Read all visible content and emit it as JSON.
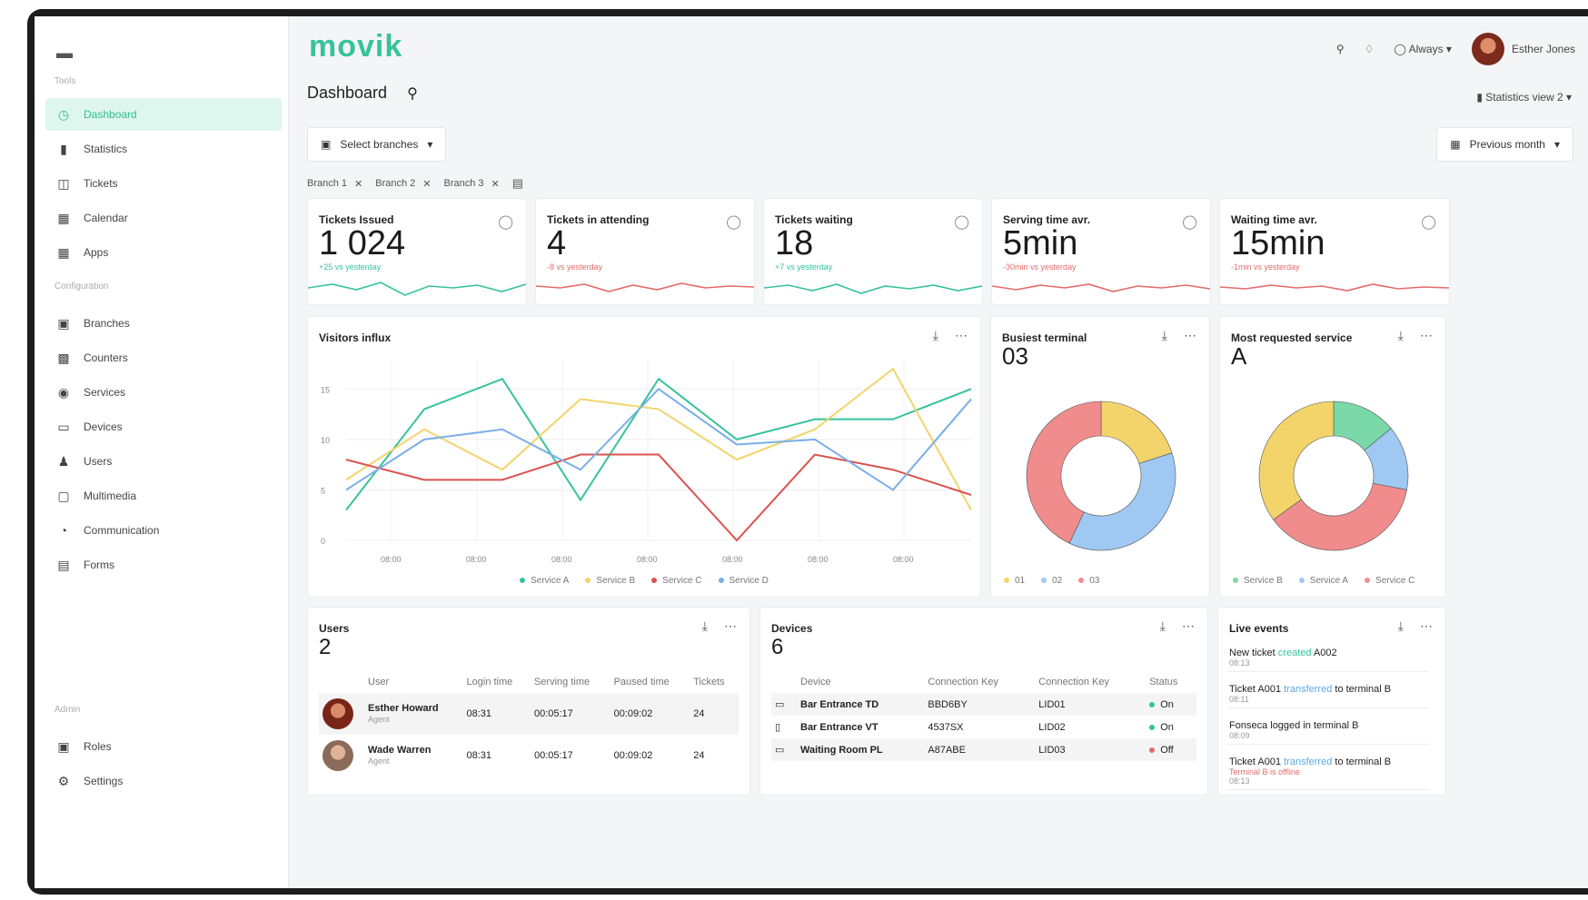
{
  "brand": {
    "logo": "movik",
    "accent": "#36c39a"
  },
  "topbar": {
    "location_label": "Always",
    "user_name": "Esther Jones"
  },
  "sidebar": {
    "section_main": "Tools",
    "main_items": [
      {
        "label": "Dashboard",
        "icon": "dashboard-icon"
      },
      {
        "label": "Statistics",
        "icon": "bar-chart-icon"
      },
      {
        "label": "Tickets",
        "icon": "ticket-icon"
      },
      {
        "label": "Calendar",
        "icon": "calendar-icon"
      },
      {
        "label": "Apps",
        "icon": "apps-icon"
      }
    ],
    "section_config": "Configuration",
    "config_items": [
      {
        "label": "Branches",
        "icon": "branch-icon"
      },
      {
        "label": "Counters",
        "icon": "counter-icon"
      },
      {
        "label": "Services",
        "icon": "services-icon"
      },
      {
        "label": "Devices",
        "icon": "devices-icon"
      },
      {
        "label": "Users",
        "icon": "users-icon"
      },
      {
        "label": "Multimedia",
        "icon": "multimedia-icon"
      },
      {
        "label": "Communication",
        "icon": "communication-icon"
      },
      {
        "label": "Forms",
        "icon": "forms-icon"
      }
    ],
    "section_admin": "Admin",
    "admin_items": [
      {
        "label": "Roles",
        "icon": "roles-icon"
      },
      {
        "label": "Settings",
        "icon": "settings-icon"
      }
    ]
  },
  "page": {
    "title": "Dashboard",
    "stats_view": "Statistics view 2"
  },
  "filters": {
    "branches_button": "Select branches",
    "period_button": "Previous month",
    "chips": [
      "Branch 1",
      "Branch 2",
      "Branch 3"
    ]
  },
  "kpis": [
    {
      "title": "Tickets Issued",
      "value": "1 024",
      "sub": "+25 vs yesterday",
      "color": "#36c39a",
      "icon": "ticket-icon"
    },
    {
      "title": "Tickets in attending",
      "value": "4",
      "sub": "-8 vs yesterday",
      "color": "#e56a6a",
      "icon": "ticket-icon"
    },
    {
      "title": "Tickets waiting",
      "value": "18",
      "sub": "+7 vs yesterday",
      "color": "#36c39a",
      "icon": "hourglass-icon"
    },
    {
      "title": "Serving time avr.",
      "value": "5min",
      "sub": "-30min vs yesterday",
      "color": "#e56a6a",
      "icon": "clock-icon"
    },
    {
      "title": "Waiting time avr.",
      "value": "15min",
      "sub": "-1min vs yesterday",
      "color": "#e56a6a",
      "icon": "hourglass-icon"
    }
  ],
  "visitors": {
    "title": "Visitors influx",
    "legend": [
      "Service A",
      "Service B",
      "Service C",
      "Service D"
    ]
  },
  "chart_data": [
    {
      "type": "line",
      "title": "Visitors influx",
      "x": [
        "08:00",
        "08:00",
        "08:00",
        "08:00",
        "08:00",
        "08:00",
        "08:00"
      ],
      "y_ticks": [
        0,
        5,
        10,
        15
      ],
      "ylim": [
        0,
        18
      ],
      "series": [
        {
          "name": "Service A",
          "color": "#36c39a",
          "values": [
            3,
            13,
            16,
            4,
            16,
            10,
            12,
            12,
            15
          ]
        },
        {
          "name": "Service B",
          "color": "#f2d46b",
          "values": [
            6,
            11,
            7,
            14,
            13,
            8,
            11,
            17,
            3
          ]
        },
        {
          "name": "Service C",
          "color": "#d9534f",
          "values": [
            8,
            6,
            6,
            8.5,
            8.5,
            0,
            8.5,
            7,
            4.5
          ]
        },
        {
          "name": "Service D",
          "color": "#7aaee8",
          "values": [
            5,
            10,
            11,
            7,
            15,
            9.5,
            10,
            5,
            14
          ]
        }
      ]
    },
    {
      "type": "pie",
      "title": "Busiest terminal",
      "series": [
        {
          "name": "01",
          "color": "#f2d46b",
          "value": 20
        },
        {
          "name": "02",
          "color": "#9fc8f2",
          "value": 37
        },
        {
          "name": "03",
          "color": "#f08c8c",
          "value": 43
        }
      ]
    },
    {
      "type": "pie",
      "title": "Most requested service",
      "series": [
        {
          "name": "Service B",
          "color": "#7bd8a8",
          "value": 14
        },
        {
          "name": "Service A",
          "color": "#9fc8f2",
          "value": 14
        },
        {
          "name": "Service C",
          "color": "#f08c8c",
          "value": 37
        },
        {
          "name": "Service D",
          "color": "#f2d46b",
          "value": 35
        }
      ]
    }
  ],
  "busiest": {
    "title": "Busiest terminal",
    "value": "03",
    "legend": [
      "01",
      "02",
      "03"
    ]
  },
  "requested": {
    "title": "Most requested service",
    "value": "A",
    "legend": [
      "Service B",
      "Service A",
      "Service C"
    ]
  },
  "users": {
    "title": "Users",
    "count": "2",
    "headers": [
      "User",
      "Login time",
      "Serving time",
      "Paused time",
      "Tickets"
    ],
    "rows": [
      {
        "name": "Esther Howard",
        "sub": "Agent",
        "login": "08:31",
        "serving": "00:05:17",
        "paused": "00:09:02",
        "tickets": "24"
      },
      {
        "name": "Wade Warren",
        "sub": "Agent",
        "login": "08:31",
        "serving": "00:05:17",
        "paused": "00:09:02",
        "tickets": "24"
      }
    ]
  },
  "devices": {
    "title": "Devices",
    "count": "6",
    "headers": [
      "Device",
      "Connection Key",
      "Connection Key",
      "Status"
    ],
    "rows": [
      {
        "icon": "monitor-icon",
        "name": "Bar Entrance TD",
        "key1": "BBD6BY",
        "key2": "LID01",
        "status": "On",
        "color": "#36c39a"
      },
      {
        "icon": "tablet-icon",
        "name": "Bar Entrance VT",
        "key1": "4537SX",
        "key2": "LID02",
        "status": "On",
        "color": "#36c39a"
      },
      {
        "icon": "monitor-icon",
        "name": "Waiting Room PL",
        "key1": "A87ABE",
        "key2": "LID03",
        "status": "Off",
        "color": "#e56a6a"
      }
    ]
  },
  "events": {
    "title": "Live events",
    "items": [
      {
        "pre": "New ticket ",
        "hl": "created",
        "post": " A002",
        "time": "08:13",
        "hl_color": "#36c39a"
      },
      {
        "pre": "Ticket A001 ",
        "hl": "transferred",
        "post": " to terminal B",
        "time": "08:11",
        "hl_color": "#5aa9e6"
      },
      {
        "pre": "Fonseca logged in terminal B",
        "hl": "",
        "post": "",
        "time": "08:09",
        "hl_color": "#5aa9e6"
      },
      {
        "pre": "Ticket A001 ",
        "hl": "transferred",
        "post": " to terminal B",
        "time": "08:13",
        "extra": "Terminal B is offline",
        "hl_color": "#5aa9e6"
      }
    ]
  }
}
